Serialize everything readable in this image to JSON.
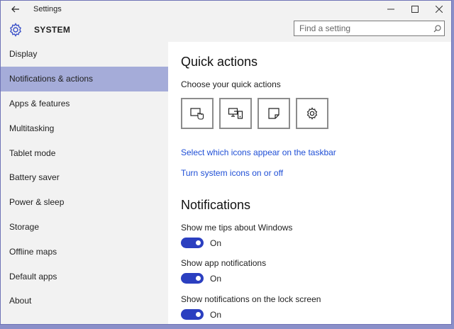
{
  "window": {
    "title": "Settings",
    "controls": {
      "minimize": "—",
      "maximize": "☐",
      "close": "✕"
    }
  },
  "header": {
    "section": "SYSTEM",
    "search_placeholder": "Find a setting"
  },
  "sidebar": {
    "items": [
      {
        "label": "Display",
        "active": false
      },
      {
        "label": "Notifications & actions",
        "active": true
      },
      {
        "label": "Apps & features",
        "active": false
      },
      {
        "label": "Multitasking",
        "active": false
      },
      {
        "label": "Tablet mode",
        "active": false
      },
      {
        "label": "Battery saver",
        "active": false
      },
      {
        "label": "Power & sleep",
        "active": false
      },
      {
        "label": "Storage",
        "active": false
      },
      {
        "label": "Offline maps",
        "active": false
      },
      {
        "label": "Default apps",
        "active": false
      },
      {
        "label": "About",
        "active": false
      }
    ]
  },
  "main": {
    "quick_actions": {
      "title": "Quick actions",
      "subtitle": "Choose your quick actions",
      "tiles": [
        {
          "icon": "tablet-mode-icon"
        },
        {
          "icon": "connect-icon"
        },
        {
          "icon": "note-icon"
        },
        {
          "icon": "settings-gear-icon"
        }
      ],
      "link_taskbar": "Select which icons appear on the taskbar",
      "link_system_icons": "Turn system icons on or off"
    },
    "notifications": {
      "title": "Notifications",
      "settings": [
        {
          "label": "Show me tips about Windows",
          "state": "On"
        },
        {
          "label": "Show app notifications",
          "state": "On"
        },
        {
          "label": "Show notifications on the lock screen",
          "state": "On"
        }
      ]
    }
  },
  "colors": {
    "accent": "#2b3fc0",
    "selection": "#a5acd9",
    "link": "#1f4fd6"
  }
}
